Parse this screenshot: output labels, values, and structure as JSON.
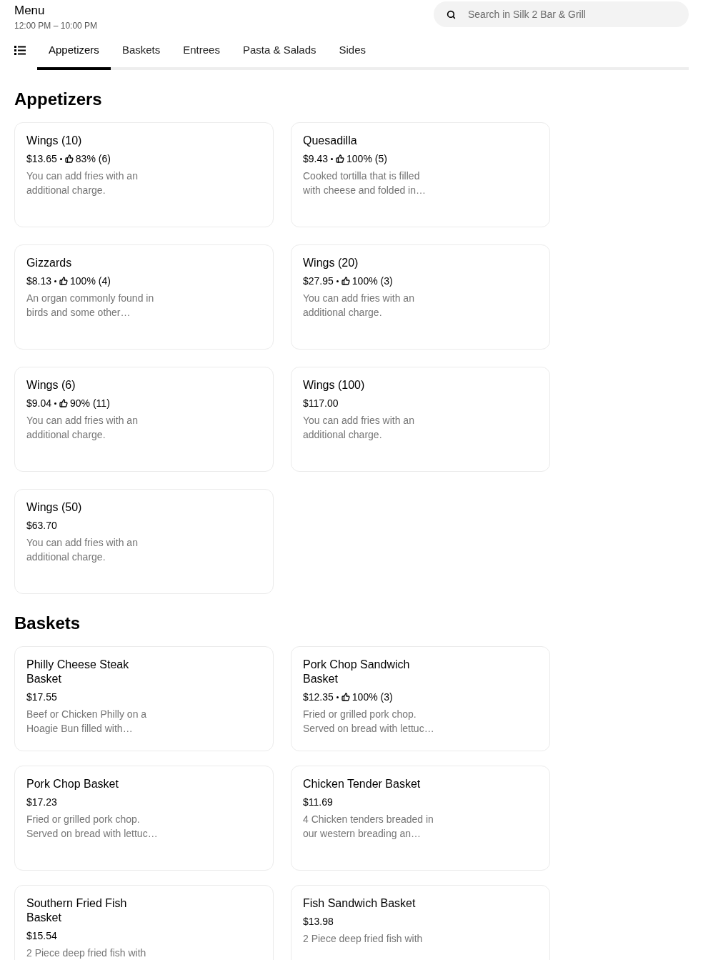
{
  "header": {
    "title": "Menu",
    "hours": "12:00 PM – 10:00 PM"
  },
  "search": {
    "placeholder": "Search in Silk 2 Bar & Grill"
  },
  "tabs": [
    {
      "label": "Appetizers",
      "selected": true
    },
    {
      "label": "Baskets",
      "selected": false
    },
    {
      "label": "Entrees",
      "selected": false
    },
    {
      "label": "Pasta & Salads",
      "selected": false
    },
    {
      "label": "Sides",
      "selected": false
    }
  ],
  "sections": [
    {
      "title": "Appetizers",
      "items": [
        {
          "name": "Wings (10)",
          "price": "$13.65",
          "rating": "83% (6)",
          "description": "You can add fries with an additional charge."
        },
        {
          "name": "Quesadilla",
          "price": "$9.43",
          "rating": "100% (5)",
          "description": "Cooked tortilla that is filled with cheese and folded in…"
        },
        {
          "name": "Gizzards",
          "price": "$8.13",
          "rating": "100% (4)",
          "description": "An organ commonly found in birds and some other…"
        },
        {
          "name": "Wings (20)",
          "price": "$27.95",
          "rating": "100% (3)",
          "description": "You can add fries with an additional charge."
        },
        {
          "name": "Wings (6)",
          "price": "$9.04",
          "rating": "90% (11)",
          "description": "You can add fries with an additional charge."
        },
        {
          "name": "Wings (100)",
          "price": "$117.00",
          "description": "You can add fries with an additional charge."
        },
        {
          "name": "Wings (50)",
          "price": "$63.70",
          "description": "You can add fries with an additional charge."
        }
      ]
    },
    {
      "title": "Baskets",
      "items": [
        {
          "name": "Philly Cheese Steak Basket",
          "price": "$17.55",
          "description": "Beef or Chicken Philly on a Hoagie Bun filled with…"
        },
        {
          "name": "Pork Chop Sandwich Basket",
          "price": "$12.35",
          "rating": "100% (3)",
          "description": "Fried or grilled pork chop. Served on bread with lettuc…"
        },
        {
          "name": "Pork Chop Basket",
          "price": "$17.23",
          "description": "Fried or grilled pork chop. Served on bread with lettuc…"
        },
        {
          "name": "Chicken Tender Basket",
          "price": "$11.69",
          "description": "4 Chicken tenders breaded in our western breading an…"
        },
        {
          "name": "Southern Fried Fish Basket",
          "price": "$15.54",
          "description": "2 Piece deep fried fish with"
        },
        {
          "name": "Fish Sandwich Basket",
          "price": "$13.98",
          "description": "2 Piece deep fried fish with"
        }
      ]
    }
  ]
}
